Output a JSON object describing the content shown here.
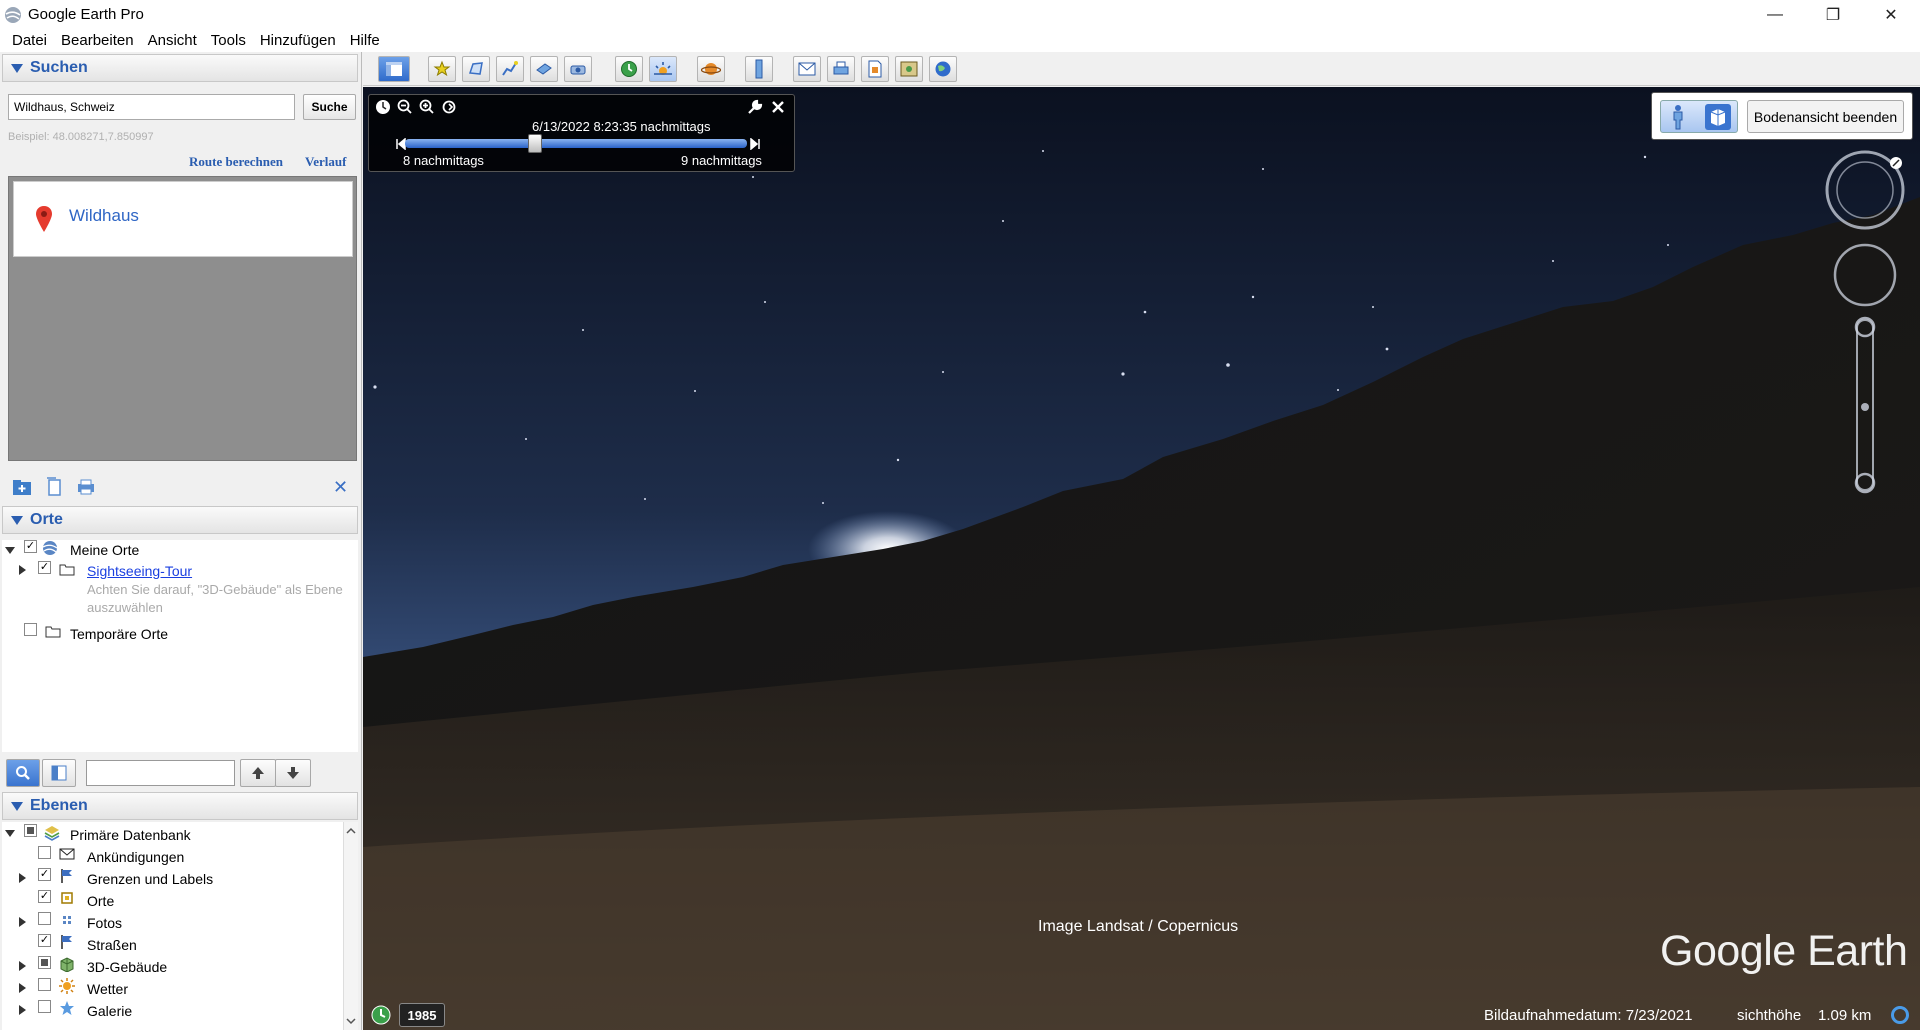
{
  "window": {
    "title": "Google Earth Pro",
    "minimize": "—",
    "maximize": "❐",
    "close": "✕"
  },
  "menu": [
    "Datei",
    "Bearbeiten",
    "Ansicht",
    "Tools",
    "Hinzufügen",
    "Hilfe"
  ],
  "search": {
    "header": "Suchen",
    "query": "Wildhaus, Schweiz",
    "button": "Suche",
    "hint": "Beispiel: 48.008271,7.850997",
    "route_link": "Route berechnen",
    "history_link": "Verlauf",
    "result_name": "Wildhaus"
  },
  "places": {
    "header": "Orte",
    "my_places": "Meine Orte",
    "tour": "Sightseeing-Tour",
    "tour_note": "Achten Sie darauf, \"3D-Gebäude\" als Ebene auszuwählen",
    "temp_places": "Temporäre Orte"
  },
  "layers": {
    "header": "Ebenen",
    "items": [
      {
        "label": "Primäre Datenbank",
        "checked": "partial"
      },
      {
        "label": "Ankündigungen",
        "checked": false
      },
      {
        "label": "Grenzen und Labels",
        "checked": true
      },
      {
        "label": "Orte",
        "checked": true
      },
      {
        "label": "Fotos",
        "checked": false
      },
      {
        "label": "Straßen",
        "checked": true
      },
      {
        "label": "3D-Gebäude",
        "checked": "partial"
      },
      {
        "label": "Wetter",
        "checked": false
      },
      {
        "label": "Galerie",
        "checked": false
      }
    ]
  },
  "time_slider": {
    "date_time": "6/13/2022   8:23:35 nachmittags",
    "start_label": "8 nachmittags",
    "end_label": "9 nachmittags",
    "position": 0.38
  },
  "ground_view": {
    "exit_button": "Bodenansicht beenden"
  },
  "viewport": {
    "attribution": "Image Landsat / Copernicus",
    "logo": "Google Earth",
    "year": "1985",
    "imagery_date": "Bildaufnahmedatum: 7/23/2021",
    "eye_alt_label": "sichthöhe",
    "eye_alt_value": "1.09 km"
  },
  "colors": {
    "accent": "#2a5db0",
    "link": "#1a3fe0",
    "sky_top": "#0b1120",
    "sky_bottom": "#3e5a8a"
  }
}
